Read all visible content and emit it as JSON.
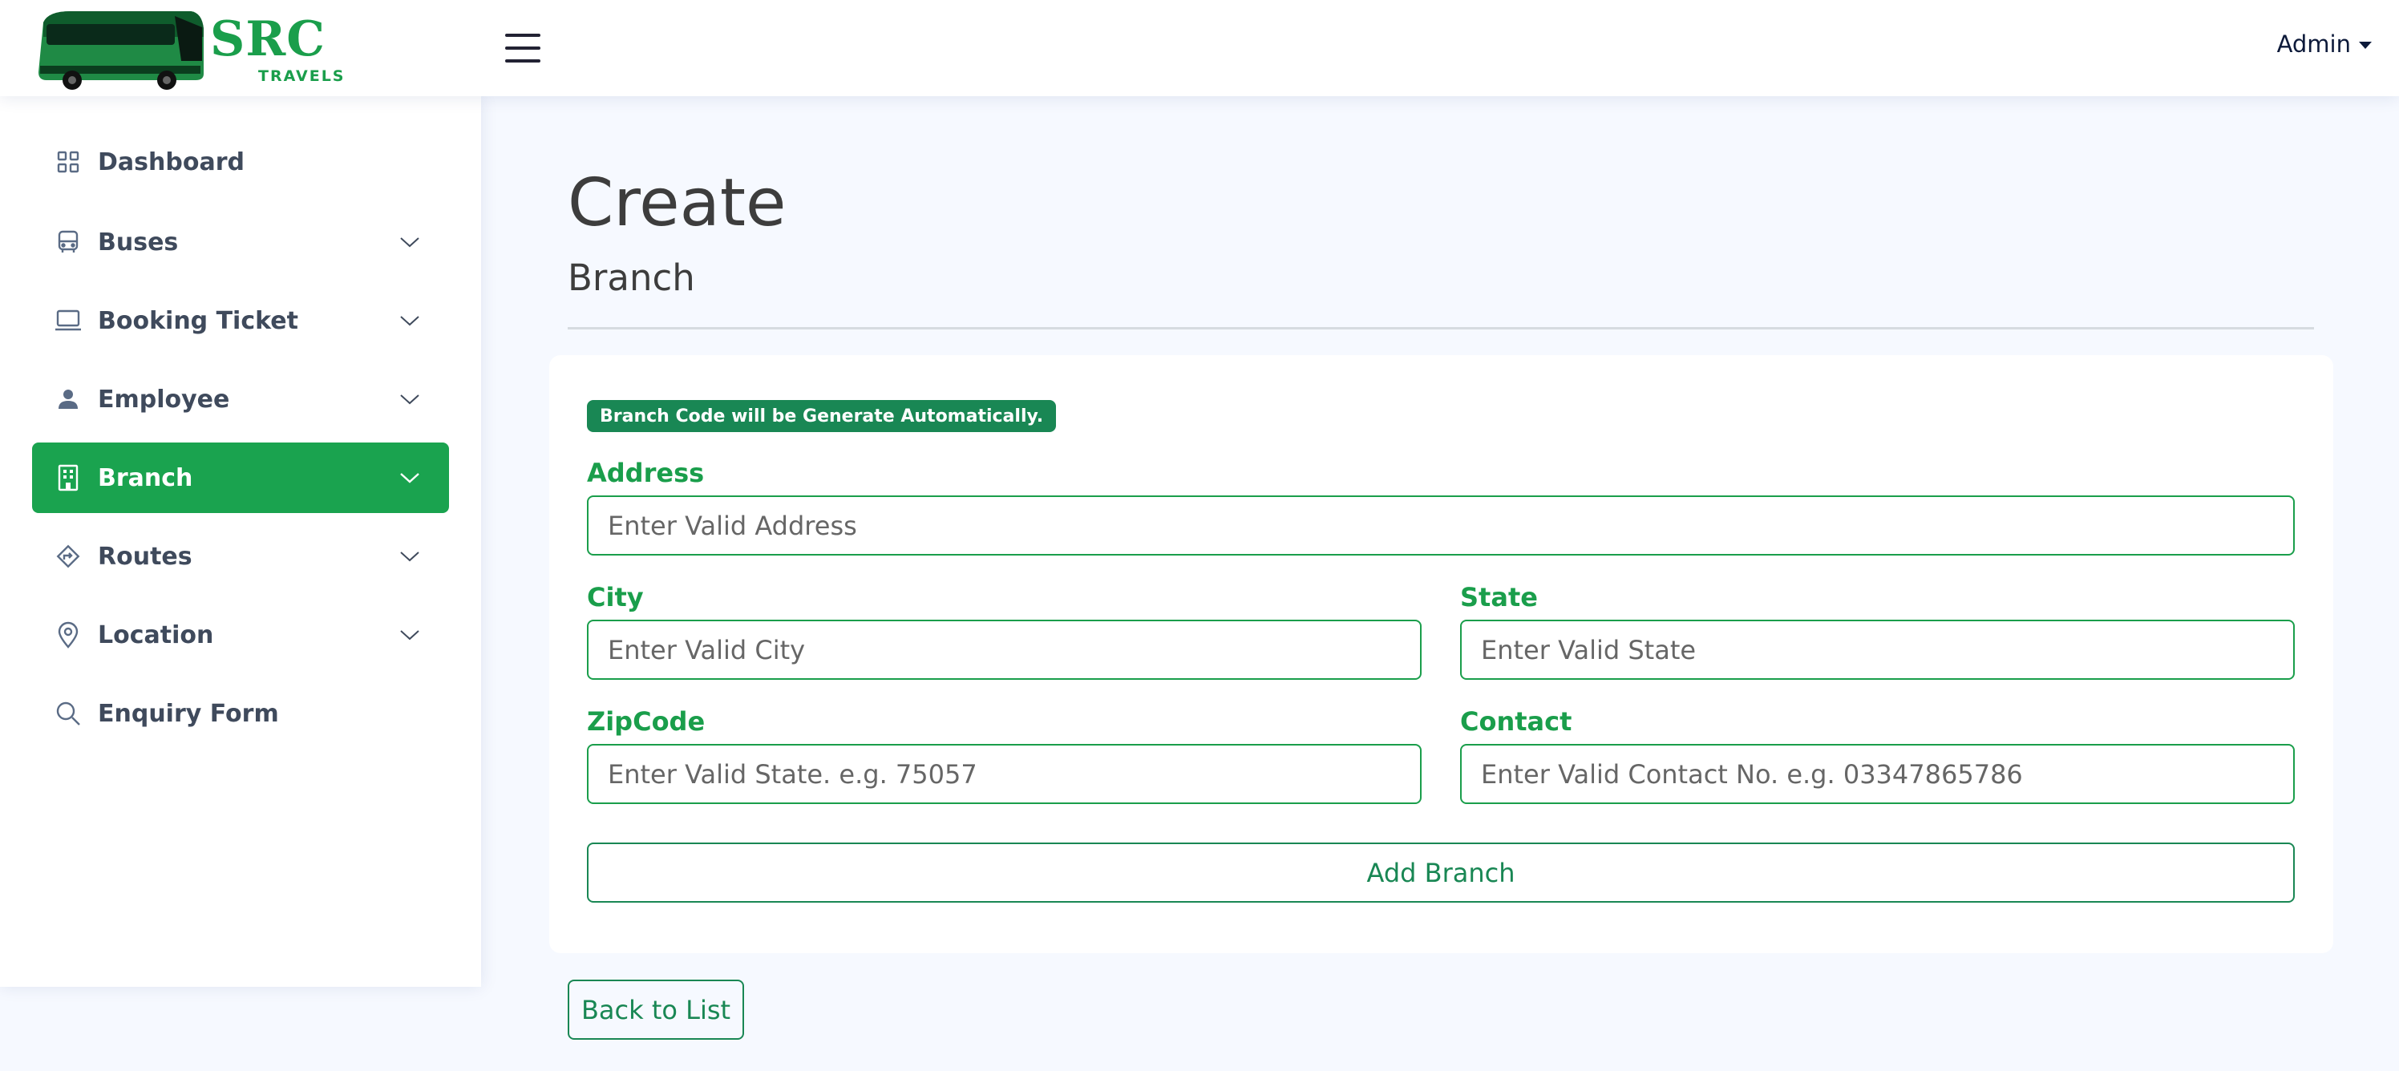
{
  "header": {
    "logo_main": "SRC",
    "logo_sub": "TRAVELS",
    "user_menu": "Admin"
  },
  "sidebar": {
    "items": [
      {
        "label": "Dashboard",
        "icon": "grid-icon",
        "has_chevron": false,
        "active": false
      },
      {
        "label": "Buses",
        "icon": "bus-icon",
        "has_chevron": true,
        "active": false
      },
      {
        "label": "Booking Ticket",
        "icon": "laptop-icon",
        "has_chevron": true,
        "active": false
      },
      {
        "label": "Employee",
        "icon": "person-icon",
        "has_chevron": true,
        "active": false
      },
      {
        "label": "Branch",
        "icon": "building-icon",
        "has_chevron": true,
        "active": true
      },
      {
        "label": "Routes",
        "icon": "signpost-icon",
        "has_chevron": true,
        "active": false
      },
      {
        "label": "Location",
        "icon": "geo-pin-icon",
        "has_chevron": true,
        "active": false
      },
      {
        "label": "Enquiry Form",
        "icon": "search-icon",
        "has_chevron": false,
        "active": false
      }
    ]
  },
  "main": {
    "title": "Create",
    "subtitle": "Branch",
    "notice": "Branch Code will be Generate Automatically.",
    "form": {
      "address": {
        "label": "Address",
        "placeholder": "Enter Valid Address",
        "value": ""
      },
      "city": {
        "label": "City",
        "placeholder": "Enter Valid City",
        "value": ""
      },
      "state": {
        "label": "State",
        "placeholder": "Enter Valid State",
        "value": ""
      },
      "zipcode": {
        "label": "ZipCode",
        "placeholder": "Enter Valid State. e.g. 75057",
        "value": ""
      },
      "contact": {
        "label": "Contact",
        "placeholder": "Enter Valid Contact No. e.g. 03347865786",
        "value": ""
      },
      "submit_label": "Add Branch"
    },
    "back_label": "Back to List"
  },
  "colors": {
    "accent": "#1aa34f",
    "accent_dark": "#198754",
    "page_bg": "#f6f9ff",
    "text": "#444444"
  }
}
